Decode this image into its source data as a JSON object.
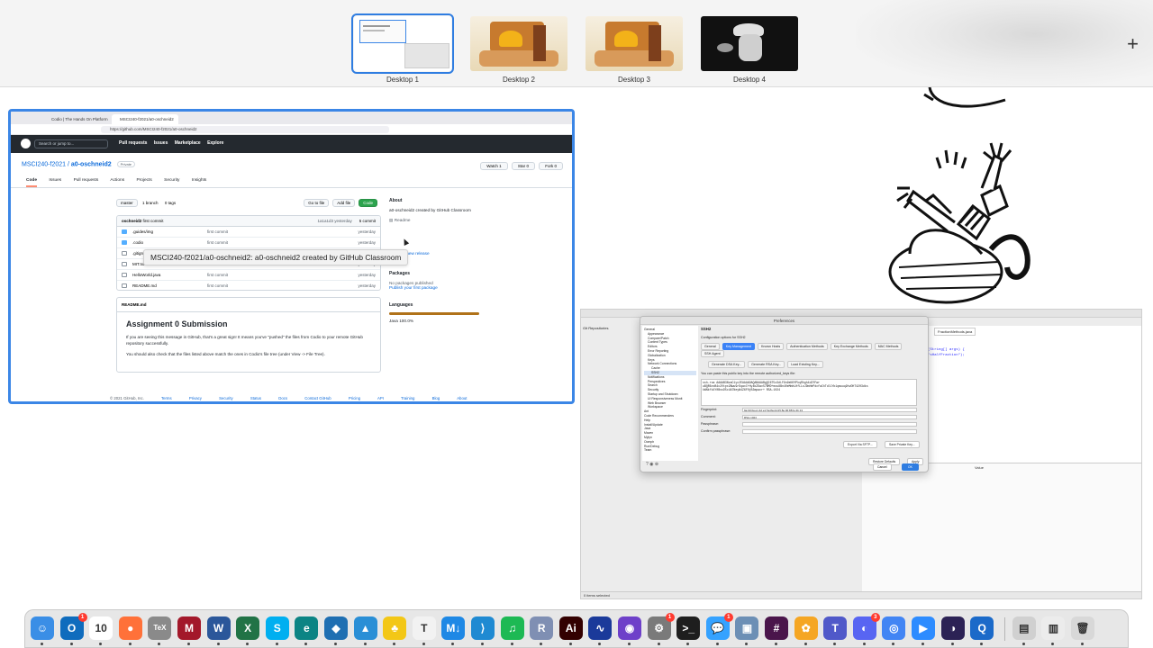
{
  "spaces": [
    {
      "label": "Desktop 1",
      "active": true
    },
    {
      "label": "Desktop 2",
      "active": false
    },
    {
      "label": "Desktop 3",
      "active": false
    },
    {
      "label": "Desktop 4",
      "active": false
    }
  ],
  "add_space_glyph": "+",
  "browser": {
    "tabs": [
      "Codio | The Hands On Platform",
      "MSCI240-f2021/a0-oschneid2"
    ],
    "url": "https://github.com/MSCI240-f2021/a0-oschneid2",
    "search_placeholder": "Search or jump to...",
    "nav": [
      "Pull requests",
      "Issues",
      "Marketplace",
      "Explore"
    ],
    "repo_owner": "MSCI240-f2021",
    "repo_name": "a0-oschneid2",
    "visibility": "Private",
    "repo_buttons": [
      "Watch",
      "1",
      "Star",
      "0",
      "Fork",
      "0"
    ],
    "repo_tabs": [
      "Code",
      "Issues",
      "Pull requests",
      "Actions",
      "Projects",
      "Security",
      "Insights"
    ],
    "branch": "master",
    "branch_count": "1 branch",
    "tag_count": "0 tags",
    "go_to_file": "Go to file",
    "add_file": "Add file",
    "code_button": "Code",
    "commit_author": "oschneid2",
    "commit_message": "first commit",
    "commit_meta": "1a1a1d3  yesterday",
    "commit_count": "5 commit",
    "files": [
      {
        "name": ".guides/img",
        "msg": "first commit",
        "time": "yesterday",
        "dir": true
      },
      {
        "name": ".codio",
        "msg": "first commit",
        "time": "yesterday",
        "dir": true
      },
      {
        "name": ".gitignore",
        "msg": "first commit",
        "time": "yesterday",
        "dir": false
      },
      {
        "name": "MIT.txt",
        "msg": "first commit",
        "time": "yesterday",
        "dir": false
      },
      {
        "name": "HelloWorld.java",
        "msg": "first commit",
        "time": "yesterday",
        "dir": false
      },
      {
        "name": "README.md",
        "msg": "first commit",
        "time": "yesterday",
        "dir": false
      }
    ],
    "readme_label": "README.md",
    "readme_title": "Assignment 0 Submission",
    "readme_p1": "If you are seeing this message in GitHub, that's a great sign! It means you've \"pushed\" the files from Codio to your remote GitHub repository successfully.",
    "readme_p2": "You should also check that the files listed above match the ones in Codio's file tree (under View -> File Tree).",
    "about_title": "About",
    "about_desc": "a0-oschneid2 created by GitHub Classroom",
    "about_readme": "Readme",
    "releases_link": "Create a new release",
    "packages_title": "Packages",
    "packages_text": "No packages published",
    "packages_link": "Publish your first package",
    "languages_title": "Languages",
    "language": "Java 100.0%",
    "tooltip": "MSCI240-f2021/a0-oschneid2: a0-oschneid2 created by GitHub Classroom",
    "footer": [
      "© 2021 GitHub, Inc.",
      "Terms",
      "Privacy",
      "Security",
      "Status",
      "Docs",
      "Contact GitHub",
      "Pricing",
      "API",
      "Training",
      "Blog",
      "About"
    ]
  },
  "eclipse": {
    "title": "Preferences",
    "section": "SSH2",
    "subtitle": "Configuration options for SSH2",
    "tabs": [
      "General",
      "Key Management",
      "Known Hosts",
      "Authentication Methods",
      "Key Exchange Methods",
      "MAC Methods",
      "SSH Agent"
    ],
    "key_buttons": [
      "Generate DSA Key...",
      "Generate RSA Key...",
      "Load Existing Key..."
    ],
    "key_note": "You can paste this public key into the remote authorized_keys file:",
    "key_text": "ssh-rsa AAAAB3NzaC1yc2EAAAADAQABAAABgQC6T5z3dLF9n9eN0fPkqRhgh4dZfFwr uBQR6vvB4c2Vtpx2Bwu9rDqaxC+Hy4bZDwv57BMD+mxu8Bn40eMmhLHfLLoJDmHePdcfaChTdl1Yb1qmuuq9hvDHT4203dks kWNkfk4Y0BssD5c4A7NeyW4Z6F0jB3mpwcr+ RSA-1024",
    "fields": [
      {
        "label": "Fingerprint:",
        "value": "9a:90:0a:e1:4d:e1:5a:8a:2d:25:8e:06:88:fe:4b:13"
      },
      {
        "label": "Comment:",
        "value": "RSA-1024"
      },
      {
        "label": "Passphrase:",
        "value": ""
      },
      {
        "label": "Confirm passphrase:",
        "value": ""
      }
    ],
    "export_button": "Export Via SFTP...",
    "save_button": "Save Private Key...",
    "restore_button": "Restore Defaults",
    "apply_button": "Apply",
    "cancel_button": "Cancel",
    "ok_button": "OK",
    "tree": [
      "General",
      "Appearance",
      "Compare/Patch",
      "Content Types",
      "Editors",
      "Error Reporting",
      "Globalization",
      "Keys",
      "Network Connections",
      "Cache",
      "SSH2",
      "Notifications",
      "Perspectives",
      "Search",
      "Security",
      "Startup and Shutdown",
      "UI Responsiveness Monit",
      "Web Browser",
      "Workspace",
      "Ant",
      "Code Recommenders",
      "Help",
      "Install/Update",
      "Java",
      "Maven",
      "Mylyn",
      "Oomph",
      "Run/Debug",
      "Team"
    ],
    "code_lines": [
      "(String[] args) {",
      "\"sHalfFraction\");"
    ],
    "editor_tab": "FractionMethods.java",
    "package_explorer": "Git Repositories",
    "value_header": "Value",
    "status": "0 items selected"
  },
  "dock": [
    {
      "name": "finder-icon",
      "color": "#3a8ee6",
      "glyph": "☺"
    },
    {
      "name": "outlook-icon",
      "color": "#0f6cbd",
      "glyph": "O",
      "badge": "1"
    },
    {
      "name": "calendar-icon",
      "color": "#ffffff",
      "glyph": "10"
    },
    {
      "name": "firefox-icon",
      "color": "#ff7139",
      "glyph": "●"
    },
    {
      "name": "tex-icon",
      "color": "#8a8a8a",
      "glyph": "TeX"
    },
    {
      "name": "mendeley-icon",
      "color": "#a3182a",
      "glyph": "M"
    },
    {
      "name": "word-icon",
      "color": "#2b579a",
      "glyph": "W"
    },
    {
      "name": "excel-icon",
      "color": "#217346",
      "glyph": "X"
    },
    {
      "name": "skype-icon",
      "color": "#00aff0",
      "glyph": "S"
    },
    {
      "name": "edge-icon",
      "color": "#0c8484",
      "glyph": "e"
    },
    {
      "name": "sourcetree-icon",
      "color": "#1f6fb2",
      "glyph": "◆"
    },
    {
      "name": "keynote-icon",
      "color": "#2a8fd6",
      "glyph": "▲"
    },
    {
      "name": "cyberduck-icon",
      "color": "#f3c716",
      "glyph": "♣"
    },
    {
      "name": "textedit-icon",
      "color": "#f2f2f2",
      "glyph": "T"
    },
    {
      "name": "markdown-icon",
      "color": "#1e88e5",
      "glyph": "M↓"
    },
    {
      "name": "vscode-icon",
      "color": "#1f8ad2",
      "glyph": "⟩"
    },
    {
      "name": "spotify-icon",
      "color": "#1db954",
      "glyph": "♫"
    },
    {
      "name": "r-icon",
      "color": "#7f8fb3",
      "glyph": "R"
    },
    {
      "name": "illustrator-icon",
      "color": "#330000",
      "glyph": "Ai"
    },
    {
      "name": "audacity-icon",
      "color": "#1b3a9a",
      "glyph": "∿"
    },
    {
      "name": "github-desktop-icon",
      "color": "#6e40c9",
      "glyph": "◉"
    },
    {
      "name": "system-preferences-icon",
      "color": "#7a7a7a",
      "glyph": "⚙",
      "badge": "1"
    },
    {
      "name": "terminal-icon",
      "color": "#1e1e1e",
      "glyph": ">_"
    },
    {
      "name": "messages-icon",
      "color": "#35a2ff",
      "glyph": "💬",
      "badge": "1"
    },
    {
      "name": "preview-icon",
      "color": "#6c8fb5",
      "glyph": "▣"
    },
    {
      "name": "slack-icon",
      "color": "#4a154b",
      "glyph": "#"
    },
    {
      "name": "photos-icon",
      "color": "#f5a623",
      "glyph": "✿"
    },
    {
      "name": "teams-icon",
      "color": "#5059c9",
      "glyph": "T"
    },
    {
      "name": "discord-icon",
      "color": "#5865f2",
      "glyph": "◐",
      "badge": "3"
    },
    {
      "name": "chrome-icon",
      "color": "#4285f4",
      "glyph": "◎"
    },
    {
      "name": "zoom-icon",
      "color": "#2d8cff",
      "glyph": "▶"
    },
    {
      "name": "eclipse-icon",
      "color": "#2c2255",
      "glyph": "◑"
    },
    {
      "name": "quicktime-icon",
      "color": "#1b6ac9",
      "glyph": "Q"
    },
    {
      "name": "downloads-icon",
      "color": "#d0d0d0",
      "glyph": "▤"
    },
    {
      "name": "documents-icon",
      "color": "#ececec",
      "glyph": "▥"
    },
    {
      "name": "trash-icon",
      "color": "#d8d8d8",
      "glyph": "🗑"
    }
  ]
}
